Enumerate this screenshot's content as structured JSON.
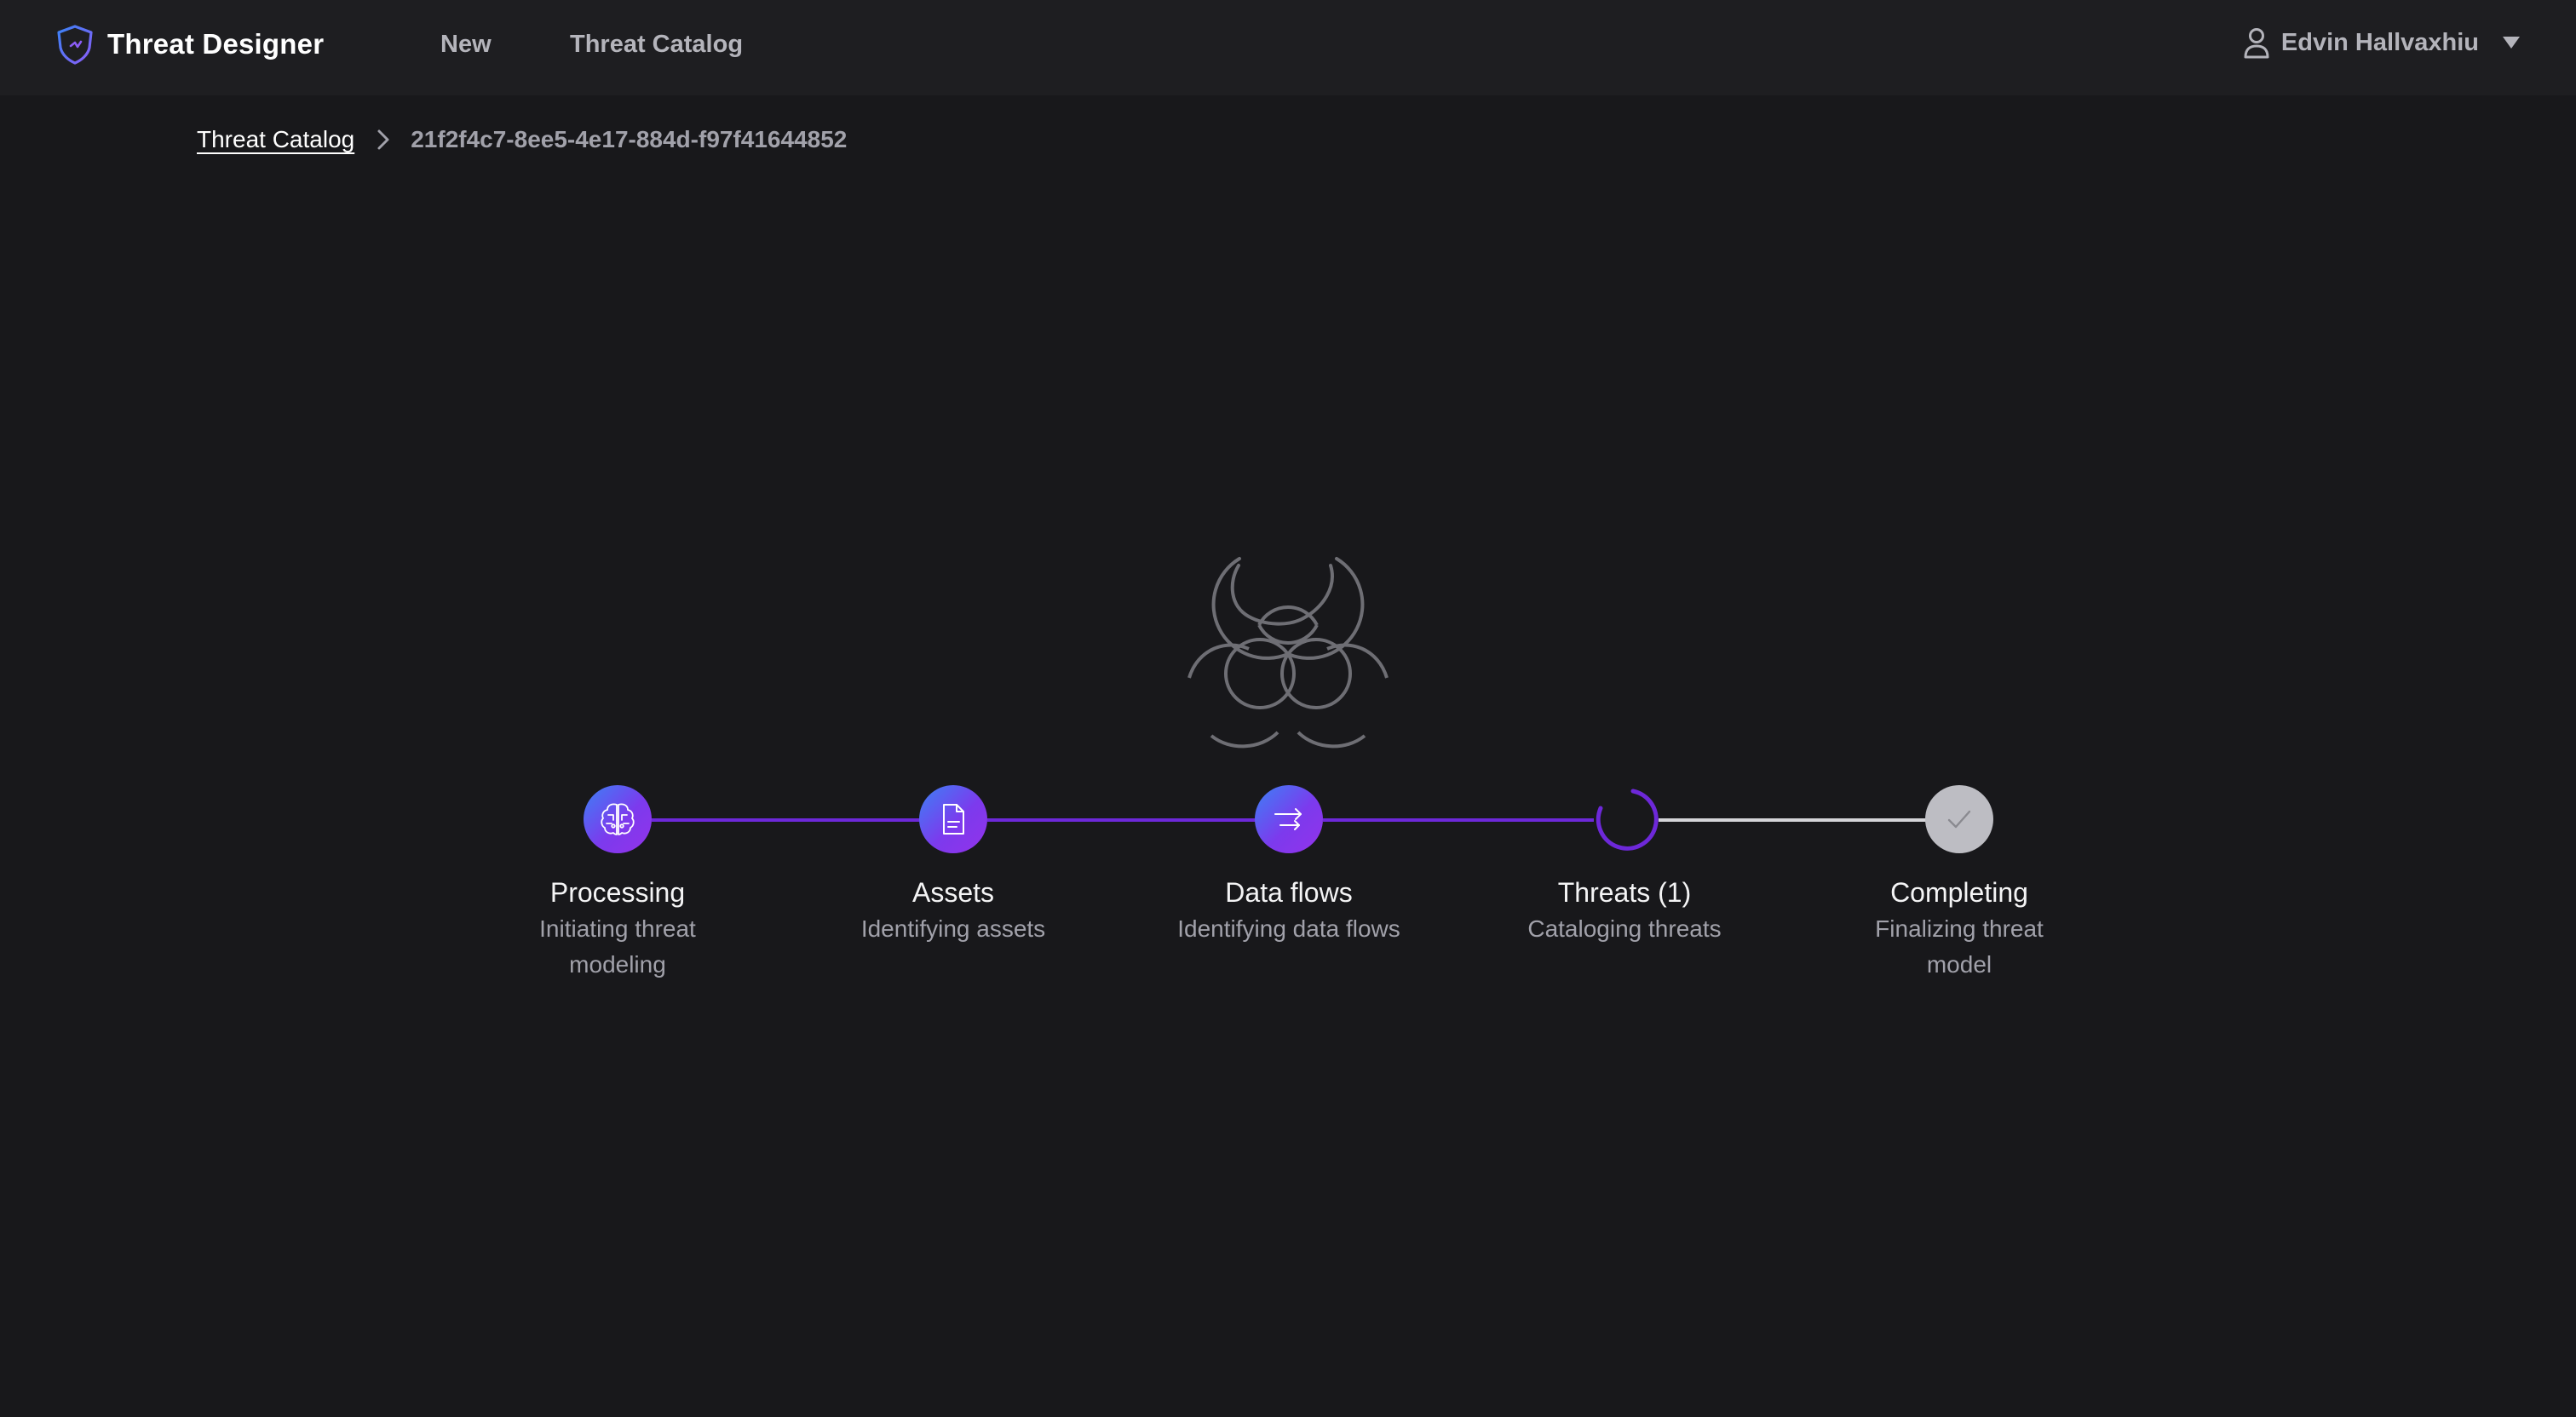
{
  "app": {
    "name": "Threat Designer",
    "accent_color": "#7c3aed",
    "background_color": "#18181b"
  },
  "nav": {
    "new_label": "New",
    "catalog_label": "Threat Catalog"
  },
  "user": {
    "name": "Edvin Hallvaxhiu",
    "icon": "user-icon"
  },
  "breadcrumb": {
    "parent": "Threat Catalog",
    "current": "21f2f4c7-8ee5-4e17-884d-f97f41644852"
  },
  "loader": {
    "icon": "biohazard-icon"
  },
  "steps": [
    {
      "title": "Processing",
      "description": "Initiating threat modeling",
      "status": "done",
      "icon": "brain-icon"
    },
    {
      "title": "Assets",
      "description": "Identifying assets",
      "status": "done",
      "icon": "document-icon"
    },
    {
      "title": "Data flows",
      "description": "Identifying data flows",
      "status": "done",
      "icon": "arrows-right-icon"
    },
    {
      "title": "Threats (1)",
      "description": "Cataloging threats",
      "status": "in-progress",
      "icon": "spinner-icon"
    },
    {
      "title": "Completing",
      "description": "Finalizing threat model",
      "status": "pending",
      "icon": "check-icon"
    }
  ]
}
